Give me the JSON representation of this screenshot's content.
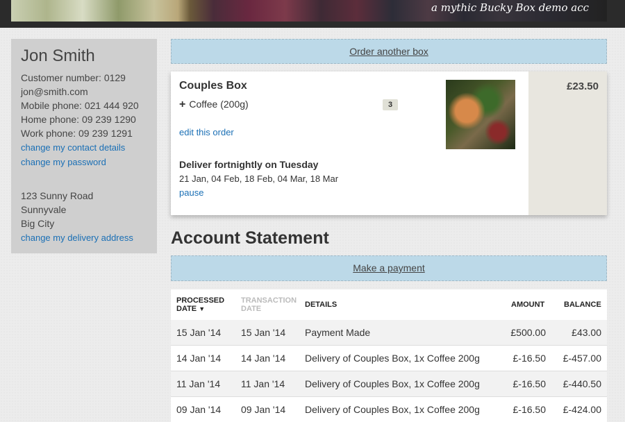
{
  "header": {
    "tagline": "a mythic Bucky Box demo acc"
  },
  "customer": {
    "name": "Jon Smith",
    "number": "Customer number: 0129",
    "email": "jon@smith.com",
    "mobile": "Mobile phone: 021 444 920",
    "home": "Home phone: 09 239 1290",
    "work": "Work phone: 09 239 1291",
    "change_contact": "change my contact details",
    "change_password": "change my password",
    "address": [
      "123 Sunny Road",
      "Sunnyvale",
      "Big City"
    ],
    "change_address": "change my delivery address"
  },
  "order_bar": {
    "label": "Order another box"
  },
  "order": {
    "box_name": "Couples Box",
    "extra": "Coffee (200g)",
    "extra_qty": "3",
    "edit_label": "edit this order",
    "schedule_title": "Deliver fortnightly on Tuesday",
    "dates": "21 Jan, 04 Feb, 18 Feb, 04 Mar, 18 Mar",
    "pause_label": "pause",
    "price": "£23.50"
  },
  "statement": {
    "title": "Account Statement",
    "payment_label": "Make a payment",
    "headers": {
      "processed_1": "PROCESSED",
      "processed_2": "DATE",
      "transaction_1": "TRANSACTION",
      "transaction_2": "DATE",
      "details": "DETAILS",
      "amount": "AMOUNT",
      "balance": "BALANCE"
    },
    "rows": [
      {
        "processed": "15 Jan '14",
        "transaction": "15 Jan '14",
        "details": "Payment Made",
        "amount": "£500.00",
        "balance": "£43.00"
      },
      {
        "processed": "14 Jan '14",
        "transaction": "14 Jan '14",
        "details": "Delivery of Couples Box, 1x Coffee 200g",
        "amount": "£-16.50",
        "balance": "£-457.00"
      },
      {
        "processed": "11 Jan '14",
        "transaction": "11 Jan '14",
        "details": "Delivery of Couples Box, 1x Coffee 200g",
        "amount": "£-16.50",
        "balance": "£-440.50"
      },
      {
        "processed": "09 Jan '14",
        "transaction": "09 Jan '14",
        "details": "Delivery of Couples Box, 1x Coffee 200g",
        "amount": "£-16.50",
        "balance": "£-424.00"
      }
    ]
  }
}
